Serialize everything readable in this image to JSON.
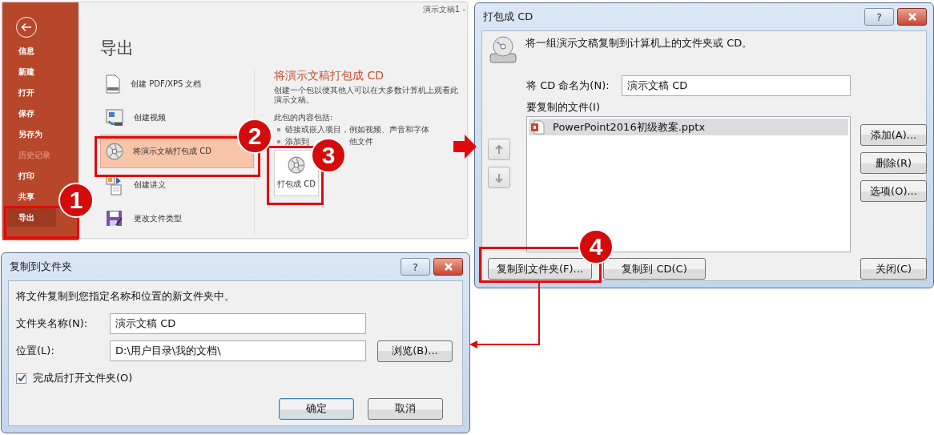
{
  "backstage": {
    "document_title": "演示文稿1 -",
    "nav": [
      {
        "label": "信息",
        "selected": false,
        "disabled": false
      },
      {
        "label": "新建",
        "selected": false,
        "disabled": false
      },
      {
        "label": "打开",
        "selected": false,
        "disabled": false
      },
      {
        "label": "保存",
        "selected": false,
        "disabled": false
      },
      {
        "label": "另存为",
        "selected": false,
        "disabled": false
      },
      {
        "label": "历史记录",
        "selected": false,
        "disabled": true
      },
      {
        "label": "打印",
        "selected": false,
        "disabled": false
      },
      {
        "label": "共享",
        "selected": false,
        "disabled": false
      },
      {
        "label": "导出",
        "selected": true,
        "disabled": false
      }
    ],
    "heading": "导出",
    "export_options": [
      {
        "label": "创建 PDF/XPS 文档",
        "kind": "pdf",
        "selected": false
      },
      {
        "label": "创建视频",
        "kind": "video",
        "selected": false
      },
      {
        "label": "将演示文稿打包成 CD",
        "kind": "cd",
        "selected": true
      },
      {
        "label": "创建讲义",
        "kind": "handout",
        "selected": false
      },
      {
        "label": "更改文件类型",
        "kind": "filetype",
        "selected": false
      }
    ],
    "detail": {
      "title": "将演示文稿打包成 CD",
      "description": "创建一个包以便其他人可以在大多数计算机上观看此演示文稿。",
      "contents_label": "此包的内容包括:",
      "bullets": [
        [
          "链接或嵌入项目，例如视频、声音和字体"
        ],
        [
          "添加到",
          "他文件"
        ]
      ],
      "action_button": "打包成 CD"
    }
  },
  "package_dialog": {
    "title": "打包成 CD",
    "help_button": "?",
    "description": "将一组演示文稿复制到计算机上的文件夹或 CD。",
    "name_label": "将 CD 命名为(N):",
    "name_value": "演示文稿 CD",
    "files_label": "要复制的文件(I)",
    "files": [
      {
        "name": "PowerPoint2016初级教案.pptx",
        "selected": true
      }
    ],
    "side_buttons": [
      "添加(A)...",
      "删除(R)",
      "选项(O)..."
    ],
    "bottom_buttons": [
      "复制到文件夹(F)...",
      "复制到 CD(C)"
    ],
    "close_button": "关闭(C)"
  },
  "folder_dialog": {
    "title": "复制到文件夹",
    "help_button": "?",
    "description": "将文件复制到您指定名称和位置的新文件夹中。",
    "folder_label": "文件夹名称(N):",
    "folder_value": "演示文稿 CD",
    "location_label": "位置(L):",
    "location_value": "D:\\用户目录\\我的文档\\",
    "browse_button": "浏览(B)...",
    "open_after": {
      "label": "完成后打开文件夹(O)",
      "checked": true
    },
    "buttons": [
      {
        "label": "确定",
        "default": true
      },
      {
        "label": "取消",
        "default": false
      }
    ]
  },
  "markers": [
    {
      "number": "1"
    },
    {
      "number": "2"
    },
    {
      "number": "3"
    },
    {
      "number": "4"
    }
  ]
}
